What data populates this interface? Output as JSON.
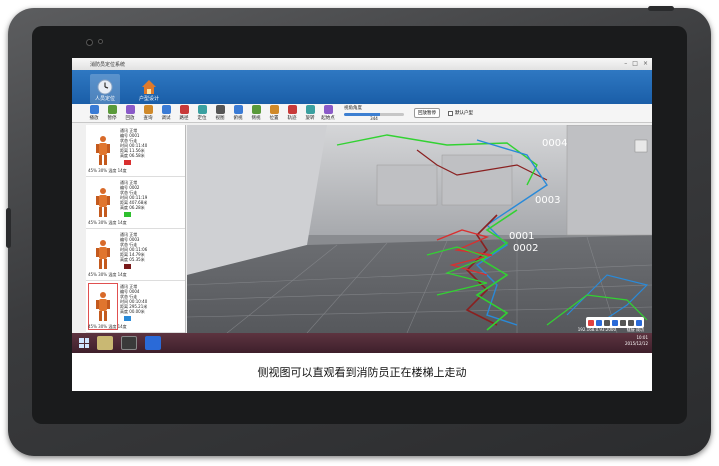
{
  "window": {
    "title": "消防员定位系统"
  },
  "ribbon": {
    "tabs": [
      {
        "label": "人员定位",
        "icon": "clock-icon"
      },
      {
        "label": "户型设计",
        "icon": "house-icon"
      }
    ]
  },
  "toolbar": {
    "buttons": [
      {
        "label": "播放",
        "color": "#3a7bd5"
      },
      {
        "label": "暂停",
        "color": "#5a9a3a"
      },
      {
        "label": "回放",
        "color": "#8a5ac8"
      },
      {
        "label": "查询",
        "color": "#d08a2a"
      },
      {
        "label": "调试",
        "color": "#3a7bd5"
      },
      {
        "label": "路径",
        "color": "#c83a3a"
      },
      {
        "label": "定位",
        "color": "#3aa0a0"
      },
      {
        "label": "视图",
        "color": "#555555"
      },
      {
        "label": "俯视",
        "color": "#3a7bd5"
      },
      {
        "label": "侧视",
        "color": "#5a9a3a"
      },
      {
        "label": "位置",
        "color": "#d08a2a"
      },
      {
        "label": "轨迹",
        "color": "#c83a3a"
      },
      {
        "label": "旋转",
        "color": "#3aa0a0"
      },
      {
        "label": "起始点",
        "color": "#8a5ac8"
      }
    ],
    "slider_label": "视角角度",
    "slider_value": "344",
    "slider_fraction": 0.6,
    "lock_label": "回放暂停",
    "checkbox_label": "默认户型"
  },
  "firefighters": [
    {
      "lines": [
        "通讯 正常",
        "编号 0001",
        "状态 行走",
        "时间 00:11:40",
        "距离 11.56米",
        "高度 06.58米"
      ],
      "foot": "45%   30%   温度 14度",
      "color": "#d93030"
    },
    {
      "lines": [
        "通讯 正常",
        "编号 0002",
        "状态 行走",
        "时间 00:11:19",
        "距离 407.68米",
        "高度 06.28米"
      ],
      "foot": "45%   30%   温度 14度",
      "color": "#2ec02e"
    },
    {
      "lines": [
        "通讯 正常",
        "编号 0003",
        "状态 行走",
        "时间 00:11:06",
        "距离 14.79米",
        "高度 05.35米"
      ],
      "foot": "45%   30%   温度 14度",
      "color": "#7a1a1a"
    },
    {
      "lines": [
        "通讯 正常",
        "编号 0004",
        "状态 行走",
        "时间 00:10:40",
        "距离 295.21米",
        "高度 00.00米"
      ],
      "foot": "45%   30%   温度 14度",
      "color": "#2a8ad8",
      "selected": true
    }
  ],
  "view": {
    "labels": [
      "0004",
      "0003",
      "0001",
      "0002"
    ]
  },
  "taskbar": {
    "ip": "192.168.0.93:2000",
    "status": "链接 成功",
    "time": "10:01",
    "date": "2015/12/12"
  },
  "caption": "侧视图可以直观看到消防员正在楼梯上走动"
}
